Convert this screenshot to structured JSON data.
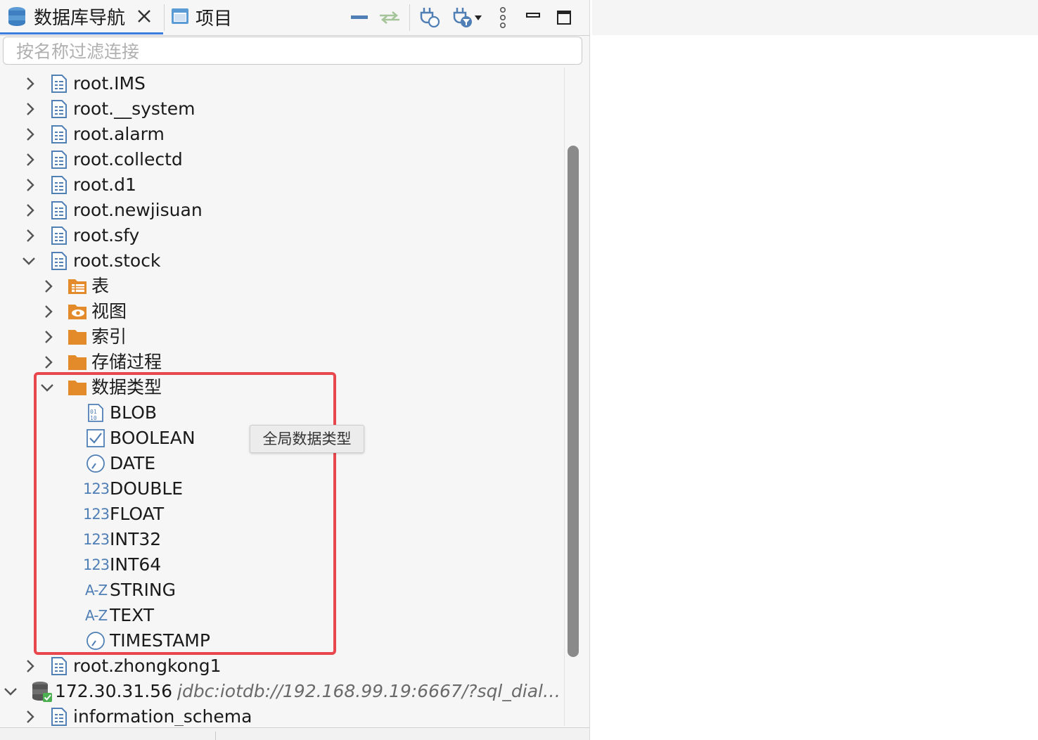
{
  "tabs": {
    "nav_label": "数据库导航",
    "project_label": "项目"
  },
  "filter": {
    "placeholder": "按名称过滤连接"
  },
  "tree": {
    "rows": [
      "root.IMS",
      "root.__system",
      "root.alarm",
      "root.collectd",
      "root.d1",
      "root.newjisuan",
      "root.sfy",
      "root.stock",
      "表",
      "视图",
      "索引",
      "存储过程",
      "数据类型",
      "BLOB",
      "BOOLEAN",
      "DATE",
      "DOUBLE",
      "FLOAT",
      "INT32",
      "INT64",
      "STRING",
      "TEXT",
      "TIMESTAMP",
      "root.zhongkong1",
      "172.30.31.56",
      "information_schema"
    ],
    "connection_url": "jdbc:iotdb://192.168.99.19:6667/?sql_dialec…",
    "num_icon": "123",
    "az_icon": "A-Z"
  },
  "tooltip": "全局数据类型",
  "colors": {
    "accent": "#3b7ddd",
    "folder": "#e38a2b",
    "highlight": "#e8474e",
    "type_icon": "#4f7fb5"
  }
}
